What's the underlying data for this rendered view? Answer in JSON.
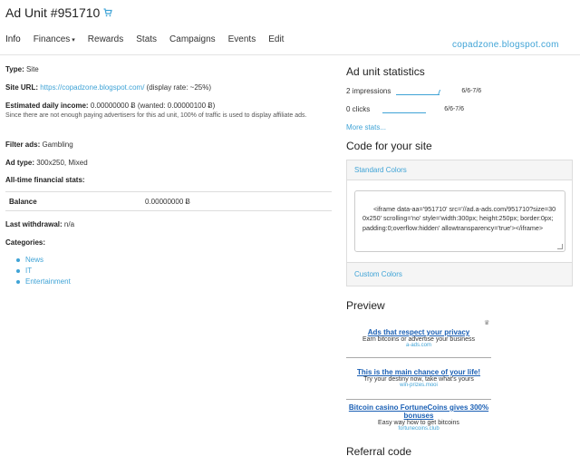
{
  "header": {
    "title": "Ad Unit #951710",
    "cart_icon": "cart-icon"
  },
  "nav": {
    "tabs": [
      {
        "label": "Info"
      },
      {
        "label": "Finances"
      },
      {
        "label": "Rewards"
      },
      {
        "label": "Stats"
      },
      {
        "label": "Campaigns"
      },
      {
        "label": "Events"
      },
      {
        "label": "Edit"
      }
    ],
    "finances_caret": "▾"
  },
  "watermark": "copadzone.blogspot.com",
  "info": {
    "type_label": "Type:",
    "type_value": " Site",
    "site_url_label": "Site URL:",
    "site_url_value": "https://copadzone.blogspot.com/",
    "site_url_extra": " (display rate: ~25%)",
    "income_label": "Estimated daily income:",
    "income_value": " 0.00000000 Ƀ (wanted: 0.00000100 Ƀ)",
    "income_note": "Since there are not enough paying advertisers for this ad unit, 100% of traffic is used to display affiliate ads.",
    "filter_label": "Filter ads:",
    "filter_value": " Gambling",
    "adtype_label": "Ad type:",
    "adtype_value": " 300x250, Mixed",
    "alltime_label": "All-time financial stats:",
    "balance_label": "Balance",
    "balance_value": "0.00000000 Ƀ",
    "withdrawal_label": "Last withdrawal:",
    "withdrawal_value": " n/a",
    "categories_label": "Categories:",
    "categories": [
      "News",
      "IT",
      "Entertainment"
    ]
  },
  "stats": {
    "heading": "Ad unit statistics",
    "impressions": "2 impressions",
    "impressions_range": "6/6-7/6",
    "clicks": "0 clicks",
    "clicks_range": "6/6-7/6",
    "more": "More stats..."
  },
  "code": {
    "heading": "Code for your site",
    "standard_colors": "Standard Colors",
    "snippet": "<iframe data-aa='951710' src='//ad.a-ads.com/951710?size=300x250' scrolling='no' style='width:300px; height:250px; border:0px; padding:0;overflow:hidden' allowtransparency='true'></iframe>",
    "custom_colors": "Custom Colors"
  },
  "preview": {
    "heading": "Preview",
    "ads": [
      {
        "title": "Ads that respect your privacy",
        "desc": "Earn bitcoins or advertise your business",
        "url": "a-ads.com"
      },
      {
        "title": "This is the main chance of your life!",
        "desc": "Try your destiny now, take what's yours",
        "url": "win-prizes.mooi"
      },
      {
        "title": "Bitcoin casino FortuneCoins gives 300% bonuses",
        "desc": "Easy way how to get bitcoins",
        "url": "fortunecoins.club"
      }
    ]
  },
  "referral": {
    "heading": "Referral code"
  }
}
